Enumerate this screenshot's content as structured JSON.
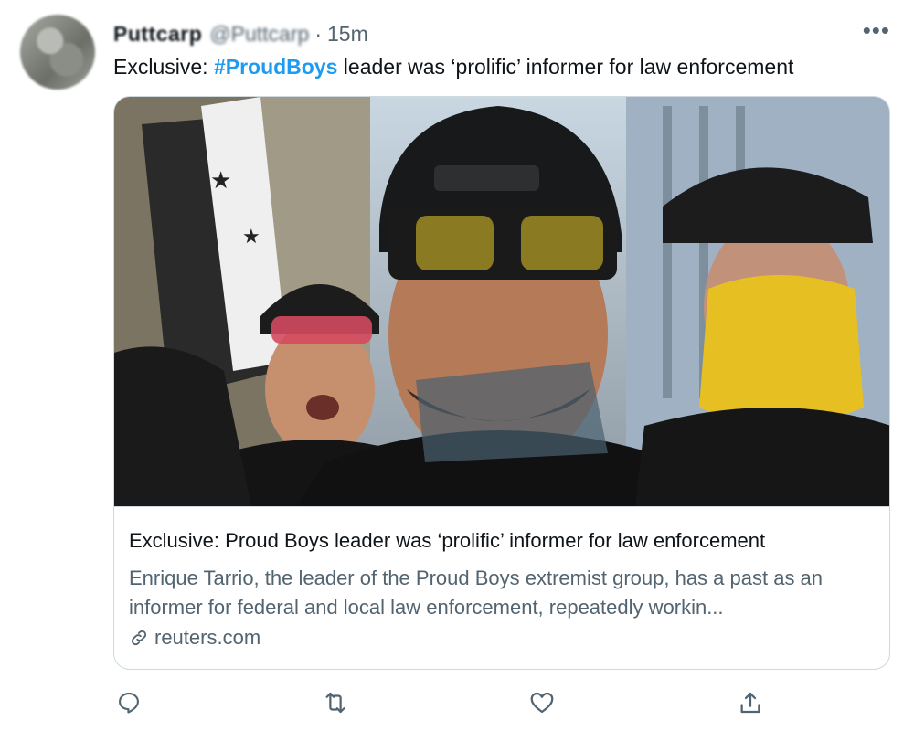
{
  "tweet": {
    "author_name": "Puttcarp",
    "author_handle": "@Puttcarp",
    "separator": "·",
    "time": "15m",
    "more_label": "•••",
    "text_prefix": "Exclusive: ",
    "hashtag": "#ProudBoys",
    "text_suffix": " leader was ‘prolific’ informer for law enforcement"
  },
  "card": {
    "title": "Exclusive: Proud Boys leader was ‘prolific’ informer for law enforcement",
    "description": "Enrique Tarrio, the leader of the Proud Boys extremist group, has a past as an informer for federal and local law enforcement, repeatedly workin...",
    "domain": "reuters.com"
  },
  "actions": {
    "icons": [
      "reply-icon",
      "retweet-icon",
      "like-icon",
      "share-icon"
    ],
    "icon_color": "#536471"
  },
  "colors": {
    "accent": "#1d9bf0",
    "text": "#0f1419",
    "secondary": "#536471",
    "border": "#cfd9de"
  }
}
